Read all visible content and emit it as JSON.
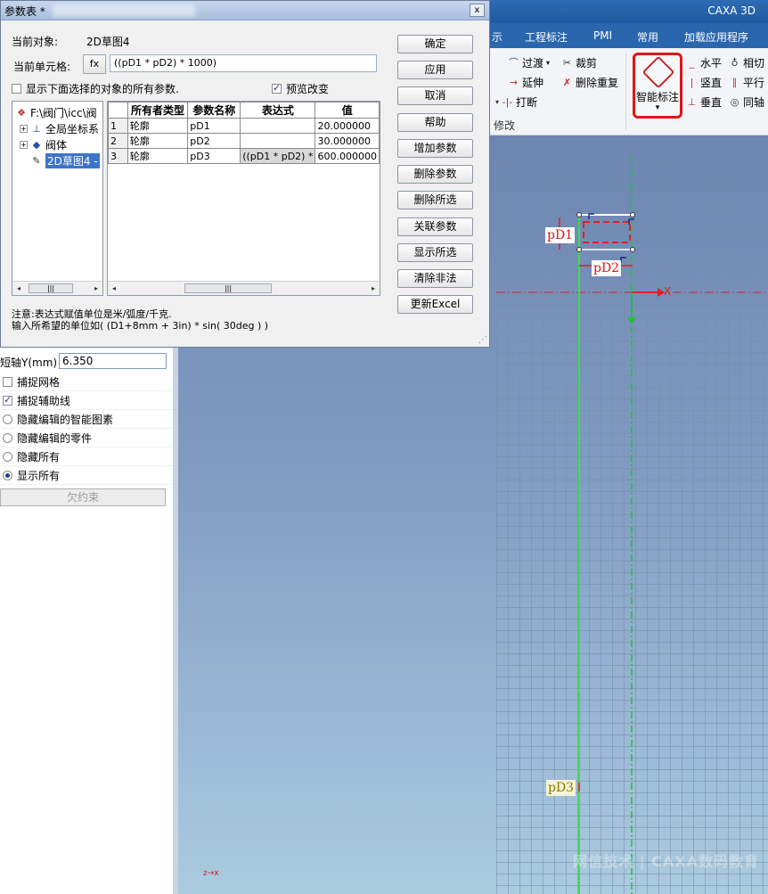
{
  "ribbon": {
    "app_title": "CAXA 3D",
    "tabs": [
      "示",
      "工程标注",
      "PMI",
      "常用",
      "加载应用程序"
    ],
    "modify": {
      "transition": "过渡",
      "trim": "裁剪",
      "extend": "延伸",
      "delete_duplicate": "删除重复",
      "break": "打断",
      "group_label": "修改"
    },
    "smart_dim": "智能标注",
    "constraints": {
      "horizontal": "水平",
      "tangent": "相切",
      "vertical": "竖直",
      "parallel": "平行",
      "perpendicular": "垂直",
      "coaxial": "同轴"
    }
  },
  "canvas": {
    "labels": {
      "pd1": "pD1",
      "pd2": "pD2",
      "pd3": "pD3",
      "x_axis": "X"
    },
    "mini_axis": "z→x",
    "watermark": "网信技术 | CAXA数码教育"
  },
  "left_panel": {
    "short_axis_label": "短轴Y(mm)",
    "short_axis_value": "6.350",
    "options": [
      {
        "label": "捕捉网格",
        "type": "checkbox",
        "checked": false
      },
      {
        "label": "捕捉辅助线",
        "type": "checkbox",
        "checked": true
      },
      {
        "label": "隐藏编辑的智能图素",
        "type": "radio",
        "checked": false
      },
      {
        "label": "隐藏编辑的零件",
        "type": "radio",
        "checked": false
      },
      {
        "label": "隐藏所有",
        "type": "radio",
        "checked": false
      },
      {
        "label": "显示所有",
        "type": "radio",
        "checked": true
      }
    ],
    "under_constrained": "欠约束"
  },
  "dialog": {
    "title": "参数表 *",
    "close": "x",
    "current_object_label": "当前对象:",
    "current_object_value": "2D草图4",
    "current_cell_label": "当前单元格:",
    "fx": "fx",
    "current_cell_value": "((pD1 * pD2) * 1000)",
    "show_all_params": "显示下面选择的对象的所有参数.",
    "preview_change": "预览改变",
    "tree": [
      {
        "label": "F:\\阀门\\icc\\阀",
        "level": 0
      },
      {
        "label": "全局坐标系",
        "level": 1
      },
      {
        "label": "阀体",
        "level": 1
      },
      {
        "label": "2D草图4 -",
        "level": 1,
        "selected": true
      }
    ],
    "table": {
      "headers": [
        "所有者类型",
        "参数名称",
        "表达式",
        "值"
      ],
      "rows": [
        {
          "n": "1",
          "owner": "轮廓",
          "name": "pD1",
          "expr": "",
          "value": "20.000000"
        },
        {
          "n": "2",
          "owner": "轮廓",
          "name": "pD2",
          "expr": "",
          "value": "30.000000"
        },
        {
          "n": "3",
          "owner": "轮廓",
          "name": "pD3",
          "expr": "((pD1 * pD2) *",
          "value": "600.000000"
        }
      ]
    },
    "buttons": [
      "确定",
      "应用",
      "取消",
      "帮助",
      "增加参数",
      "删除参数",
      "删除所选",
      "关联参数",
      "显示所选",
      "清除非法",
      "更新Excel"
    ],
    "note_line1": "注意:表达式赋值单位是米/弧度/千克.",
    "note_line2": "输入所希望的单位如( (D1+8mm + 3in) * sin( 30deg ) )"
  }
}
